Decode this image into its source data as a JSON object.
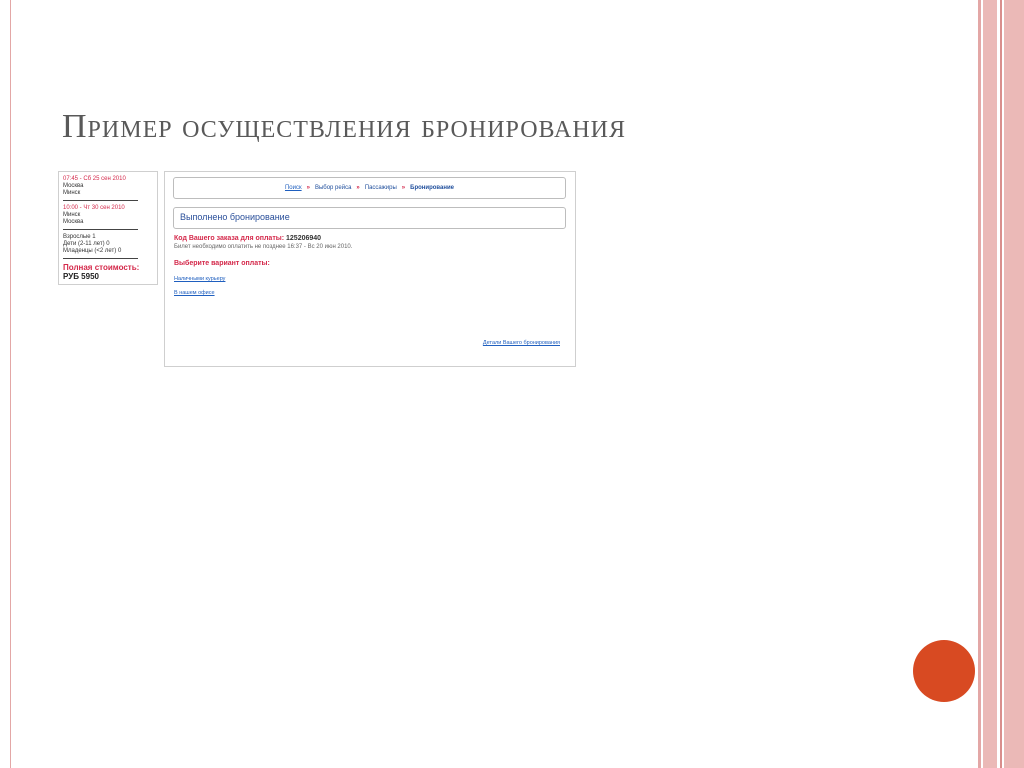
{
  "slide": {
    "title": "Пример осуществления бронирования"
  },
  "summary": {
    "flight1": {
      "time": "07:45 - Сб 25 сен 2010",
      "from": "Москва",
      "to": "Минск"
    },
    "flight2": {
      "time": "10:00 - Чт 30 сен 2010",
      "from": "Минск",
      "to": "Москва"
    },
    "passengers": [
      "Взрослые   1",
      "Дети (2-11 лет)   0",
      "Младенцы (<2 лет)   0"
    ],
    "total_label": "Полная стоимость:",
    "total_value": "РУБ 5950"
  },
  "breadcrumb": {
    "search": "Поиск",
    "separator": "»",
    "flight": "Выбор рейса",
    "passengers": "Пассажиры",
    "booking": "Бронирование"
  },
  "booking": {
    "status": "Выполнено бронирование",
    "order_label": "Код Вашего заказа для оплаты:",
    "order_code": "125206940",
    "deadline": "Билет необходимо оплатить не позднее 16:37 - Вс 20 июн 2010.",
    "choose_payment": "Выберите вариант оплаты:",
    "option_courier": "Наличными курьеру",
    "option_office": "В нашем офисе",
    "details_link": "Детали Вашего бронирования"
  },
  "colors": {
    "accent_red": "#d4284a",
    "link_blue": "#1f5fbf",
    "title_gray": "#595959",
    "decoration_circle": "#d84a22",
    "stripe_pink": "#e8b4b2"
  }
}
